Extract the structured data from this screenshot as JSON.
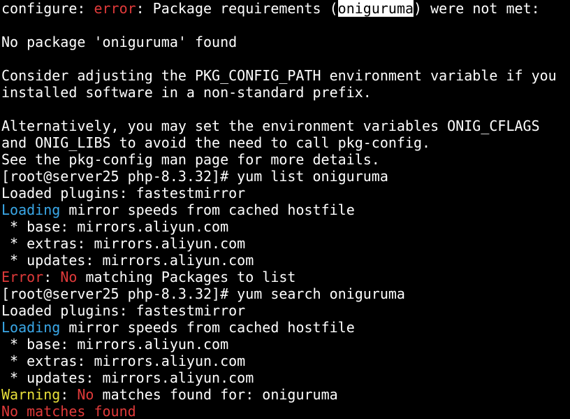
{
  "colors": {
    "background": "#000000",
    "default_text": "#ffffff",
    "error_red": "#e03a3a",
    "info_cyan": "#3aa8e8",
    "warning_yellow": "#e8e03a",
    "highlight_bg": "#ffffff",
    "highlight_fg": "#000000"
  },
  "lines": [
    {
      "segments": [
        {
          "text": "configure: ",
          "color": "default"
        },
        {
          "text": "error",
          "color": "red"
        },
        {
          "text": ": Package requirements (",
          "color": "default"
        },
        {
          "text": "oniguruma",
          "color": "highlight"
        },
        {
          "text": ") were not met:",
          "color": "default"
        }
      ]
    },
    {
      "segments": []
    },
    {
      "segments": [
        {
          "text": "No package 'oniguruma' found",
          "color": "default"
        }
      ]
    },
    {
      "segments": []
    },
    {
      "segments": [
        {
          "text": "Consider adjusting the PKG_CONFIG_PATH environment variable if you",
          "color": "default"
        }
      ]
    },
    {
      "segments": [
        {
          "text": "installed software in a non-standard prefix.",
          "color": "default"
        }
      ]
    },
    {
      "segments": []
    },
    {
      "segments": [
        {
          "text": "Alternatively, you may set the environment variables ONIG_CFLAGS",
          "color": "default"
        }
      ]
    },
    {
      "segments": [
        {
          "text": "and ONIG_LIBS to avoid the need to call pkg-config.",
          "color": "default"
        }
      ]
    },
    {
      "segments": [
        {
          "text": "See the pkg-config man page for more details.",
          "color": "default"
        }
      ]
    },
    {
      "segments": [
        {
          "text": "[root@server25 php-8.3.32]# yum list oniguruma",
          "color": "default"
        }
      ]
    },
    {
      "segments": [
        {
          "text": "Loaded plugins: fastestmirror",
          "color": "default"
        }
      ]
    },
    {
      "segments": [
        {
          "text": "Loading",
          "color": "cyan"
        },
        {
          "text": " mirror speeds from cached hostfile",
          "color": "default"
        }
      ]
    },
    {
      "segments": [
        {
          "text": " * base: mirrors.aliyun.com",
          "color": "default"
        }
      ]
    },
    {
      "segments": [
        {
          "text": " * extras: mirrors.aliyun.com",
          "color": "default"
        }
      ]
    },
    {
      "segments": [
        {
          "text": " * updates: mirrors.aliyun.com",
          "color": "default"
        }
      ]
    },
    {
      "segments": [
        {
          "text": "Error",
          "color": "red"
        },
        {
          "text": ": ",
          "color": "default"
        },
        {
          "text": "No",
          "color": "red"
        },
        {
          "text": " matching Packages to list",
          "color": "default"
        }
      ]
    },
    {
      "segments": [
        {
          "text": "[root@server25 php-8.3.32]# yum search oniguruma",
          "color": "default"
        }
      ]
    },
    {
      "segments": [
        {
          "text": "Loaded plugins: fastestmirror",
          "color": "default"
        }
      ]
    },
    {
      "segments": [
        {
          "text": "Loading",
          "color": "cyan"
        },
        {
          "text": " mirror speeds from cached hostfile",
          "color": "default"
        }
      ]
    },
    {
      "segments": [
        {
          "text": " * base: mirrors.aliyun.com",
          "color": "default"
        }
      ]
    },
    {
      "segments": [
        {
          "text": " * extras: mirrors.aliyun.com",
          "color": "default"
        }
      ]
    },
    {
      "segments": [
        {
          "text": " * updates: mirrors.aliyun.com",
          "color": "default"
        }
      ]
    },
    {
      "segments": [
        {
          "text": "Warning",
          "color": "yellow"
        },
        {
          "text": ": ",
          "color": "default"
        },
        {
          "text": "No",
          "color": "red"
        },
        {
          "text": " matches found for: oniguruma",
          "color": "default"
        }
      ]
    },
    {
      "segments": [
        {
          "text": "No matches found",
          "color": "red"
        }
      ]
    }
  ]
}
